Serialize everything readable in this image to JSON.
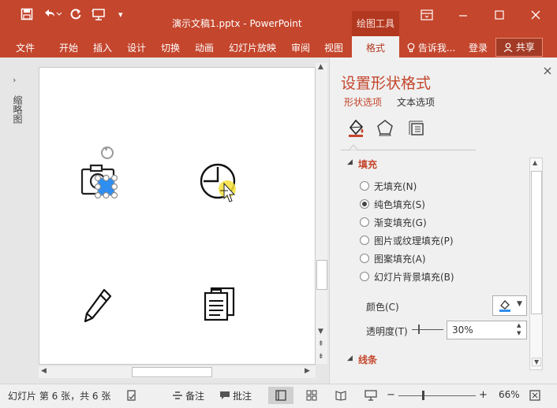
{
  "window": {
    "title": "演示文稿1.pptx - PowerPoint",
    "context_group": "绘图工具",
    "qat_icons": [
      "save-icon",
      "undo-icon",
      "redo-icon",
      "start-from-beginning-icon",
      "customize-qat-icon"
    ]
  },
  "ribbon": {
    "tabs": [
      "文件",
      "开始",
      "插入",
      "设计",
      "切换",
      "动画",
      "幻灯片放映",
      "审阅",
      "视图"
    ],
    "active_tab": "格式",
    "tell_me": "告诉我...",
    "login": "登录",
    "share": "共享"
  },
  "left_panel": {
    "label": "缩略图",
    "expand_icon": "chevron-right-icon"
  },
  "format_pane": {
    "title": "设置形状格式",
    "tabs": [
      "形状选项",
      "文本选项"
    ],
    "active_tab": "形状选项",
    "icons": [
      "fill-line-icon",
      "effects-icon",
      "size-properties-icon"
    ],
    "fill_section": "填充",
    "fill_options": [
      {
        "label": "无填充(N)",
        "selected": false
      },
      {
        "label": "纯色填充(S)",
        "selected": true
      },
      {
        "label": "渐变填充(G)",
        "selected": false
      },
      {
        "label": "图片或纹理填充(P)",
        "selected": false
      },
      {
        "label": "图案填充(A)",
        "selected": false
      },
      {
        "label": "幻灯片背景填充(B)",
        "selected": false
      }
    ],
    "color_label": "颜色(C)",
    "transparency_label": "透明度(T)",
    "transparency_value": "30%",
    "line_section": "线条",
    "accent_color": "#c4462d",
    "fill_color": "#2f8ef0"
  },
  "slide": {
    "icons": [
      "camera-icon",
      "clock-icon",
      "pencil-icon",
      "documents-icon"
    ]
  },
  "status_bar": {
    "slide_info": "幻灯片 第 6 张，共 6 张",
    "notes": "备注",
    "comments": "批注",
    "zoom": "66%"
  }
}
